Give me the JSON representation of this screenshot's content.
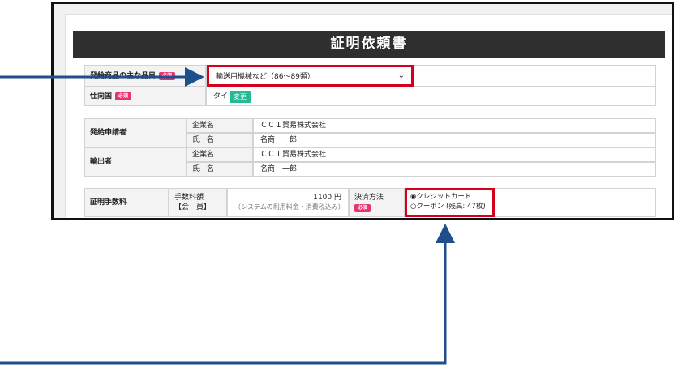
{
  "dialog_title": "証明依頼書",
  "rows": {
    "goods_label": "発給商品の主な品目",
    "goods_value": "輸送用機械など（86～89類）",
    "destination_label": "仕向国",
    "destination_value": "タイ",
    "change_button": "変更",
    "required_badge": "必須"
  },
  "applicant": {
    "label": "発給申請者",
    "company_label": "企業名",
    "company_value": "ＣＣＩ貿易株式会社",
    "name_label": "氏　名",
    "name_value": "名商　一郎"
  },
  "exporter": {
    "label": "輸出者",
    "company_label": "企業名",
    "company_value": "ＣＣＩ貿易株式会社",
    "name_label": "氏　名",
    "name_value": "名商　一郎"
  },
  "fee": {
    "label": "証明手数料",
    "fee_label_line1": "手数料額",
    "fee_label_line2": "【会　員】",
    "amount": "1100 円",
    "note": "（システムの利用料金・消費税込み）",
    "payment_label": "決済方法",
    "option_credit": "◉クレジットカード",
    "option_coupon": "○クーポン (残高: 47枚)"
  },
  "colors": {
    "highlight_red": "#d6001c",
    "arrow_blue": "#1f4e8c",
    "title_bg": "#2f2f2f",
    "button_teal": "#25b996",
    "required_pink": "#e8336f"
  }
}
